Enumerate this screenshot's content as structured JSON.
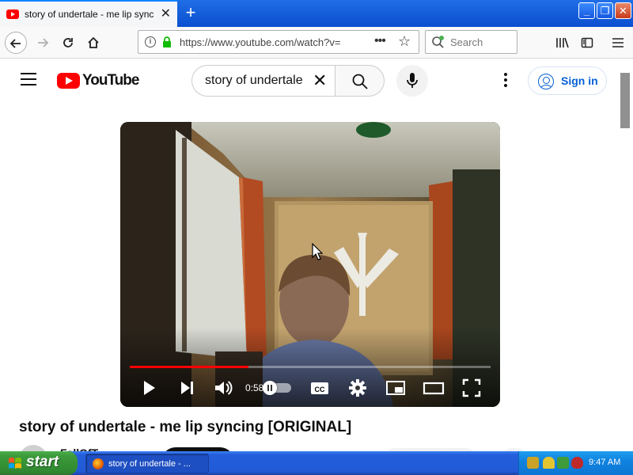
{
  "browser": {
    "tab": {
      "title": "story of undertale - me lip syncing",
      "close_glyph": "✕"
    },
    "new_tab_glyph": "+",
    "window_controls": {
      "minimize": "_",
      "maximize": "❐",
      "close": "✕"
    },
    "url": "https://www.youtube.com/watch?v=",
    "search_placeholder": "Search",
    "icons": [
      "back-arrow-icon",
      "forward-arrow-icon",
      "reload-icon",
      "home-icon",
      "info-icon",
      "lock-icon",
      "bookmark-star-icon",
      "library-icon",
      "sidebar-icon",
      "hamburger-menu-icon"
    ]
  },
  "youtube": {
    "logo_text": "YouTube",
    "search_query": "story of undertale",
    "clear_glyph": "✕",
    "signin_label": "Sign in",
    "video": {
      "title": "story of undertale - me lip syncing [ORIGINAL]",
      "current_time": "0:58",
      "progress": 0.33,
      "channel_name": "FallOfT"
    }
  },
  "taskbar": {
    "start_label": "start",
    "task_label": "story of undertale - ...",
    "clock": "9:47 AM"
  },
  "colors": {
    "xp_blue": "#245edb",
    "start_green": "#3c9a3c",
    "youtube_red": "#ff0000",
    "signin_blue": "#065fd4"
  }
}
